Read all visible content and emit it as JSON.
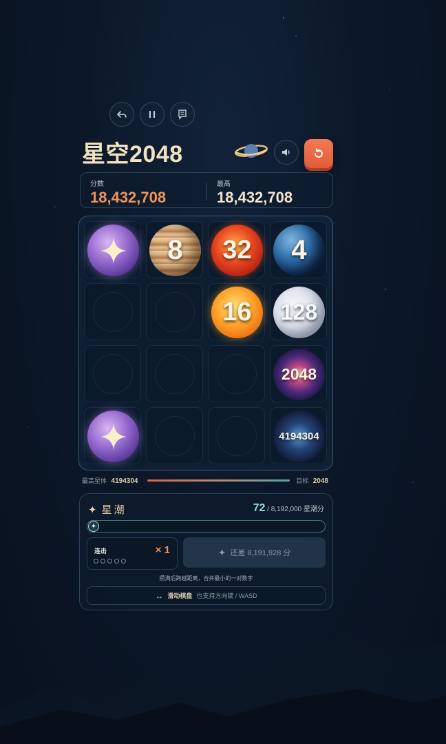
{
  "app": {
    "title": "星空2048"
  },
  "toolbar": {
    "icons": [
      "undo-icon",
      "pause-icon",
      "notes-icon"
    ],
    "sound_icon": "speaker-icon",
    "restart_icon": "restart-icon"
  },
  "score": {
    "score_label": "分数",
    "score_value": "18,432,708",
    "best_label": "最高",
    "best_value": "18,432,708"
  },
  "board": {
    "rows": [
      [
        {
          "kind": "star",
          "value": ""
        },
        {
          "kind": "jupiter",
          "value": "8"
        },
        {
          "kind": "sun32",
          "value": "32"
        },
        {
          "kind": "earth",
          "value": "4"
        }
      ],
      [
        {
          "kind": "empty",
          "value": ""
        },
        {
          "kind": "empty",
          "value": ""
        },
        {
          "kind": "sun16",
          "value": "16"
        },
        {
          "kind": "moon",
          "value": "128"
        }
      ],
      [
        {
          "kind": "empty",
          "value": ""
        },
        {
          "kind": "empty",
          "value": ""
        },
        {
          "kind": "empty",
          "value": ""
        },
        {
          "kind": "galaxy",
          "value": "2048"
        }
      ],
      [
        {
          "kind": "star",
          "value": ""
        },
        {
          "kind": "empty",
          "value": ""
        },
        {
          "kind": "empty",
          "value": ""
        },
        {
          "kind": "cluster",
          "value": "4194304"
        }
      ]
    ]
  },
  "progress": {
    "highest_label": "最高星体",
    "highest_value": "4194304",
    "target_label": "目标",
    "target_value": "2048"
  },
  "tide": {
    "title": "星潮",
    "current": "72",
    "total": "/ 8,192,000 星潮分",
    "fill_fraction": 8.8e-06,
    "combo_label": "连击",
    "combo_multiplier": "× 1",
    "combo_dots": 5,
    "remaining": "还差 8,191,928 分",
    "hint": "攒满后跨越距离，合并最小的一对数字",
    "swipe_label": "滑动棋盘",
    "swipe_sub": "也支持方向键 / WASD"
  },
  "colors": {
    "accent_orange": "#f47a54",
    "score_orange": "#f0955a",
    "tide_cyan": "#8ee0e0"
  }
}
